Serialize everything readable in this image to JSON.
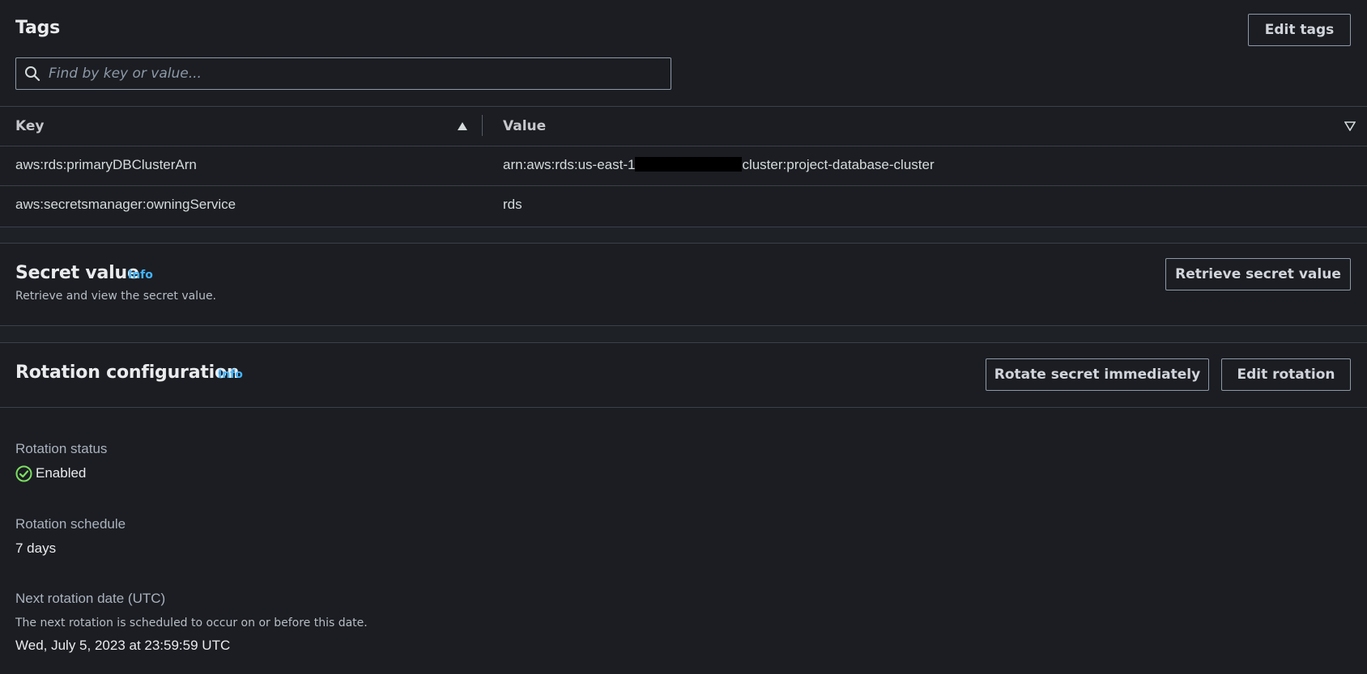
{
  "tags": {
    "title": "Tags",
    "edit_button": "Edit tags",
    "search_placeholder": "Find by key or value...",
    "columns": [
      "Key",
      "Value"
    ],
    "rows": [
      {
        "key": "aws:rds:primaryDBClusterArn",
        "value_prefix": "arn:aws:rds:us-east-1",
        "value_suffix": "cluster:project-database-cluster"
      },
      {
        "key": "aws:secretsmanager:owningService",
        "value": "rds"
      }
    ]
  },
  "secret_value": {
    "title": "Secret value",
    "info": "Info",
    "description": "Retrieve and view the secret value.",
    "button": "Retrieve secret value"
  },
  "rotation": {
    "title": "Rotation configuration",
    "info": "Info",
    "rotate_button": "Rotate secret immediately",
    "edit_button": "Edit rotation",
    "status_label": "Rotation status",
    "status_value": "Enabled",
    "schedule_label": "Rotation schedule",
    "schedule_value": "7 days",
    "next_label": "Next rotation date (UTC)",
    "next_description": "The next rotation is scheduled to occur on or before this date.",
    "next_value": "Wed, July 5, 2023 at 23:59:59 UTC"
  },
  "colors": {
    "background": "#1b1d22",
    "info_link": "#42b4ff",
    "success": "#7cde61"
  }
}
